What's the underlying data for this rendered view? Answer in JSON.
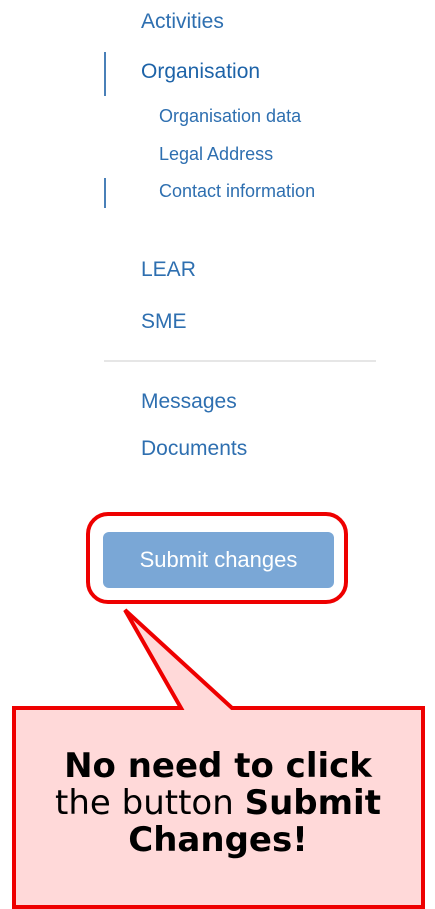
{
  "nav": {
    "activities": "Activities",
    "organisation": "Organisation",
    "organisation_data": "Organisation data",
    "legal_address": "Legal Address",
    "contact_information": "Contact information",
    "lear": "LEAR",
    "sme": "SME",
    "messages": "Messages",
    "documents": "Documents"
  },
  "submit_button": {
    "label": "Submit changes"
  },
  "callout": {
    "line1": "No need to click",
    "line2_prefix": "the button ",
    "line2_bold": "Submit",
    "line3": "Changes!"
  },
  "colors": {
    "link": "#2e6fb0",
    "button_bg": "#7aa7d6",
    "callout_fill": "#ffd9d9",
    "callout_border": "#ee0000"
  }
}
